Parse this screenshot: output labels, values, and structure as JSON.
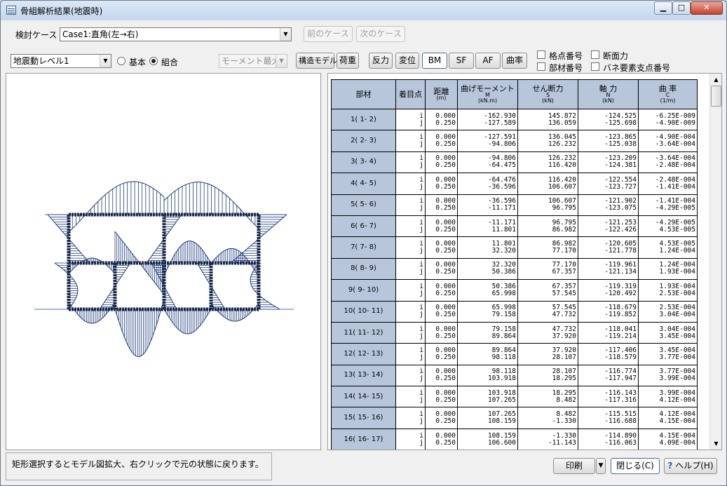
{
  "window": {
    "title": "骨組解析結果(地震時)"
  },
  "toolbar": {
    "case_label": "検討ケース",
    "case_value": "Case1:直角(左→右)",
    "prev_case": "前のケース",
    "next_case": "次のケース",
    "level_value": "地震動レベル1",
    "radio_basic": "基本",
    "radio_combo": "組合",
    "radio_selected": "組合",
    "moment_select": "モーメント最大",
    "buttons": {
      "structure_model": "構造モデル",
      "load": "荷重",
      "reaction": "反力",
      "displacement": "変位",
      "bm": "BM",
      "sf": "SF",
      "af": "AF",
      "curvature": "曲率"
    },
    "active_view": "BM",
    "checkboxes": {
      "node_number": "格点番号",
      "member_number": "部材番号",
      "section_force": "断面力",
      "spring_support": "バネ要素支点番号"
    }
  },
  "table": {
    "headers": {
      "member": "部材",
      "point": "着目点",
      "distance": "距離",
      "distance_unit": "(m)",
      "moment": "曲げモーメント",
      "moment_sym": "M",
      "moment_unit": "(kN.m)",
      "shear": "せん断力",
      "shear_sym": "S",
      "shear_unit": "(kN)",
      "axial": "軸 力",
      "axial_sym": "N",
      "axial_unit": "(kN)",
      "curv": "曲 率",
      "curv_sym": "C",
      "curv_unit": "(1/m)"
    },
    "rows": [
      {
        "member": "1( 1- 2)",
        "i": "i",
        "j": "j",
        "d_i": "0.000",
        "d_j": "0.250",
        "m_i": "-162.930",
        "m_j": "-127.589",
        "s_i": "145.872",
        "s_j": "136.059",
        "n_i": "-124.525",
        "n_j": "-125.698",
        "c_i": "-6.25E-009",
        "c_j": "-4.90E-009"
      },
      {
        "member": "2( 2- 3)",
        "i": "i",
        "j": "j",
        "d_i": "0.000",
        "d_j": "0.250",
        "m_i": "-127.591",
        "m_j": "-94.806",
        "s_i": "136.045",
        "s_j": "126.232",
        "n_i": "-123.865",
        "n_j": "-125.038",
        "c_i": "-4.90E-004",
        "c_j": "-3.64E-004"
      },
      {
        "member": "3( 3- 4)",
        "i": "i",
        "j": "j",
        "d_i": "0.000",
        "d_j": "0.250",
        "m_i": "-94.806",
        "m_j": "-64.475",
        "s_i": "126.232",
        "s_j": "116.420",
        "n_i": "-123.209",
        "n_j": "-124.381",
        "c_i": "-3.64E-004",
        "c_j": "-2.48E-004"
      },
      {
        "member": "4( 4- 5)",
        "i": "i",
        "j": "j",
        "d_i": "0.000",
        "d_j": "0.250",
        "m_i": "-64.476",
        "m_j": "-36.596",
        "s_i": "116.420",
        "s_j": "106.607",
        "n_i": "-122.554",
        "n_j": "-123.727",
        "c_i": "-2.48E-004",
        "c_j": "-1.41E-004"
      },
      {
        "member": "5( 5- 6)",
        "i": "i",
        "j": "j",
        "d_i": "0.000",
        "d_j": "0.250",
        "m_i": "-36.596",
        "m_j": "-11.171",
        "s_i": "106.607",
        "s_j": "96.795",
        "n_i": "-121.902",
        "n_j": "-123.075",
        "c_i": "-1.41E-004",
        "c_j": "-4.29E-005"
      },
      {
        "member": "6( 6- 7)",
        "i": "i",
        "j": "j",
        "d_i": "0.000",
        "d_j": "0.250",
        "m_i": "-11.171",
        "m_j": "11.801",
        "s_i": "96.795",
        "s_j": "86.982",
        "n_i": "-121.253",
        "n_j": "-122.426",
        "c_i": "-4.29E-005",
        "c_j": "4.53E-005"
      },
      {
        "member": "7( 7- 8)",
        "i": "i",
        "j": "j",
        "d_i": "0.000",
        "d_j": "0.250",
        "m_i": "11.801",
        "m_j": "32.320",
        "s_i": "86.982",
        "s_j": "77.170",
        "n_i": "-120.605",
        "n_j": "-121.778",
        "c_i": "4.53E-005",
        "c_j": "1.24E-004"
      },
      {
        "member": "8( 8- 9)",
        "i": "i",
        "j": "j",
        "d_i": "0.000",
        "d_j": "0.250",
        "m_i": "32.320",
        "m_j": "50.386",
        "s_i": "77.170",
        "s_j": "67.357",
        "n_i": "-119.961",
        "n_j": "-121.134",
        "c_i": "1.24E-004",
        "c_j": "1.93E-004"
      },
      {
        "member": "9( 9- 10)",
        "i": "i",
        "j": "j",
        "d_i": "0.000",
        "d_j": "0.250",
        "m_i": "50.386",
        "m_j": "65.998",
        "s_i": "67.357",
        "s_j": "57.545",
        "n_i": "-119.319",
        "n_j": "-120.492",
        "c_i": "1.93E-004",
        "c_j": "2.53E-004"
      },
      {
        "member": "10( 10- 11)",
        "i": "i",
        "j": "j",
        "d_i": "0.000",
        "d_j": "0.250",
        "m_i": "65.998",
        "m_j": "79.158",
        "s_i": "57.545",
        "s_j": "47.732",
        "n_i": "-118.679",
        "n_j": "-119.852",
        "c_i": "2.53E-004",
        "c_j": "3.04E-004"
      },
      {
        "member": "11( 11- 12)",
        "i": "i",
        "j": "j",
        "d_i": "0.000",
        "d_j": "0.250",
        "m_i": "79.158",
        "m_j": "89.864",
        "s_i": "47.732",
        "s_j": "37.920",
        "n_i": "-118.041",
        "n_j": "-119.214",
        "c_i": "3.04E-004",
        "c_j": "3.45E-004"
      },
      {
        "member": "12( 12- 13)",
        "i": "i",
        "j": "j",
        "d_i": "0.000",
        "d_j": "0.250",
        "m_i": "89.864",
        "m_j": "98.118",
        "s_i": "37.920",
        "s_j": "28.107",
        "n_i": "-117.406",
        "n_j": "-118.579",
        "c_i": "3.45E-004",
        "c_j": "3.77E-004"
      },
      {
        "member": "13( 13- 14)",
        "i": "i",
        "j": "j",
        "d_i": "0.000",
        "d_j": "0.250",
        "m_i": "98.118",
        "m_j": "103.918",
        "s_i": "28.107",
        "s_j": "18.295",
        "n_i": "-116.774",
        "n_j": "-117.947",
        "c_i": "3.77E-004",
        "c_j": "3.99E-004"
      },
      {
        "member": "14( 14- 15)",
        "i": "i",
        "j": "j",
        "d_i": "0.000",
        "d_j": "0.250",
        "m_i": "103.918",
        "m_j": "107.265",
        "s_i": "18.295",
        "s_j": "8.482",
        "n_i": "-116.143",
        "n_j": "-117.316",
        "c_i": "3.99E-004",
        "c_j": "4.12E-004"
      },
      {
        "member": "15( 15- 16)",
        "i": "i",
        "j": "j",
        "d_i": "0.000",
        "d_j": "0.250",
        "m_i": "107.265",
        "m_j": "108.159",
        "s_i": "8.482",
        "s_j": "-1.330",
        "n_i": "-115.515",
        "n_j": "-116.688",
        "c_i": "4.12E-004",
        "c_j": "4.15E-004"
      },
      {
        "member": "16( 16- 17)",
        "i": "i",
        "j": "j",
        "d_i": "0.000",
        "d_j": "0.250",
        "m_i": "108.159",
        "m_j": "106.600",
        "s_i": "-1.330",
        "s_j": "-11.143",
        "n_i": "-114.890",
        "n_j": "-116.063",
        "c_i": "4.15E-004",
        "c_j": "4.09E-004"
      }
    ]
  },
  "status": {
    "message": "矩形選択するとモデル図拡大、右クリックで元の状態に戻ります。"
  },
  "footer": {
    "print": "印刷",
    "close": "閉じる(C)",
    "help": "ヘルプ(H)"
  },
  "colors": {
    "diagram": "#1f3d7a",
    "frame": "#1a2a4a",
    "header": "#b7c6db"
  }
}
